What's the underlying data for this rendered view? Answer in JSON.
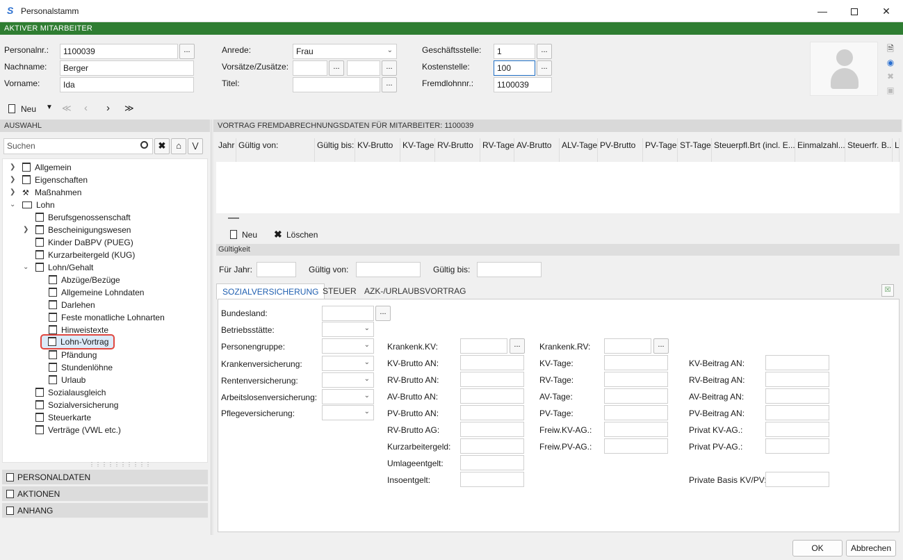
{
  "window": {
    "title": "Personalstamm"
  },
  "banner": "AKTIVER MITARBEITER",
  "header": {
    "personalnr_label": "Personalnr.:",
    "personalnr_value": "1100039",
    "nachname_label": "Nachname:",
    "nachname_value": "Berger",
    "vorname_label": "Vorname:",
    "vorname_value": "Ida",
    "anrede_label": "Anrede:",
    "anrede_value": "Frau",
    "vorsaetze_label": "Vorsätze/Zusätze:",
    "titel_label": "Titel:",
    "geschaeftsstelle_label": "Geschäftsstelle:",
    "geschaeftsstelle_value": "1",
    "kostenstelle_label": "Kostenstelle:",
    "kostenstelle_value": "100",
    "fremdlohnnr_label": "Fremdlohnnr.:",
    "fremdlohnnr_value": "1100039",
    "dots": "..."
  },
  "toolbar": {
    "new_label": "Neu",
    "first": "≪",
    "prev": "‹",
    "next": "›",
    "last": "≫"
  },
  "left": {
    "section_title": "AUSWAHL",
    "search_placeholder": "Suchen",
    "tree": [
      {
        "label": "Allgemein"
      },
      {
        "label": "Eigenschaften"
      },
      {
        "label": "Maßnahmen"
      },
      {
        "label": "Lohn"
      },
      {
        "label": "Berufsgenossenschaft"
      },
      {
        "label": "Bescheinigungswesen"
      },
      {
        "label": "Kinder DaBPV (PUEG)"
      },
      {
        "label": "Kurzarbeitergeld (KUG)"
      },
      {
        "label": "Lohn/Gehalt"
      },
      {
        "label": "Abzüge/Bezüge"
      },
      {
        "label": "Allgemeine Lohndaten"
      },
      {
        "label": "Darlehen"
      },
      {
        "label": "Feste monatliche Lohnarten"
      },
      {
        "label": "Hinweistexte"
      },
      {
        "label": "Lohn-Vortrag"
      },
      {
        "label": "Pfändung"
      },
      {
        "label": "Stundenlöhne"
      },
      {
        "label": "Urlaub"
      },
      {
        "label": "Sozialausgleich"
      },
      {
        "label": "Sozialversicherung"
      },
      {
        "label": "Steuerkarte"
      },
      {
        "label": "Verträge (VWL etc.)"
      }
    ],
    "accordion": [
      "PERSONALDATEN",
      "AKTIONEN",
      "ANHANG"
    ]
  },
  "main": {
    "section_title": "VORTRAG FREMDABRECHNUNGSDATEN FÜR MITARBEITER: 1100039",
    "columns": [
      "Jahr",
      "Gültig von:",
      "Gültig bis:",
      "KV-Brutto",
      "KV-Tage",
      "RV-Brutto",
      "RV-Tage",
      "AV-Brutto",
      "ALV-Tage",
      "PV-Brutto",
      "PV-Tage",
      "ST-Tage",
      "Steuerpfl.Brt (incl. E...",
      "Einmalzahl...",
      "Steuerfr. B...",
      "L"
    ],
    "new_label": "Neu",
    "delete_label": "Löschen",
    "validity_title": "Gültigkeit",
    "fuer_jahr_label": "Für Jahr:",
    "gueltig_von_label": "Gültig von:",
    "gueltig_bis_label": "Gültig bis:",
    "tabs": [
      "SOZIALVERSICHERUNG",
      "STEUER",
      "AZK-/URLAUBSVORTRAG"
    ],
    "sv": {
      "bundesland": "Bundesland:",
      "betriebsstaette": "Betriebsstätte:",
      "personengruppe": "Personengruppe:",
      "krankenversicherung": "Krankenversicherung:",
      "rentenversicherung": "Rentenversicherung:",
      "arbeitslosenversicherung": "Arbeitslosenversicherung:",
      "pflegeversicherung": "Pflegeversicherung:",
      "col2": [
        "Krankenk.KV:",
        "KV-Brutto AN:",
        "RV-Brutto AN:",
        "AV-Brutto AN:",
        "PV-Brutto AN:",
        "RV-Brutto AG:",
        "Kurzarbeitergeld:",
        "Umlageentgelt:",
        "Insoentgelt:"
      ],
      "col3": [
        "Krankenk.RV:",
        "KV-Tage:",
        "RV-Tage:",
        "AV-Tage:",
        "PV-Tage:",
        "Freiw.KV-AG.:",
        "Freiw.PV-AG.:"
      ],
      "col4": [
        "KV-Beitrag AN:",
        "RV-Beitrag AN:",
        "AV-Beitrag AN:",
        "PV-Beitrag AN:",
        "Privat KV-AG.:",
        "Privat PV-AG.:",
        "Private Basis KV/PV:"
      ]
    }
  },
  "footer": {
    "ok_label": "OK",
    "cancel_label": "Abbrechen"
  }
}
